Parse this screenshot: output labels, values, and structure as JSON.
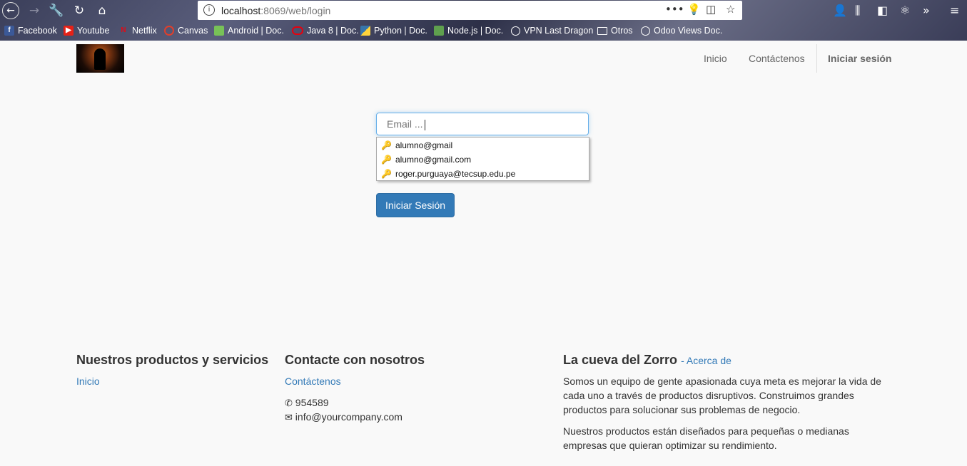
{
  "browser": {
    "url_host": "localhost",
    "url_path": ":8069/web/login",
    "bookmarks": [
      {
        "label": "Facebook",
        "icon": "facebook-icon",
        "color": "#3b5998"
      },
      {
        "label": "Youtube",
        "icon": "youtube-icon",
        "color": "#e62117"
      },
      {
        "label": "Netflix",
        "icon": "netflix-icon",
        "color": "#e50914"
      },
      {
        "label": "Canvas",
        "icon": "canvas-icon",
        "color": "#e13f2b"
      },
      {
        "label": "Android | Doc.",
        "icon": "android-icon",
        "color": "#78c257"
      },
      {
        "label": "Java 8 | Doc.",
        "icon": "oracle-icon",
        "color": "#e8000d"
      },
      {
        "label": "Python | Doc.",
        "icon": "python-icon",
        "color": "#3776ab"
      },
      {
        "label": "Node.js |  Doc.",
        "icon": "nodejs-icon",
        "color": "#5fa04e"
      },
      {
        "label": "VPN Last Dragon",
        "icon": "globe-icon",
        "color": "#ffffff"
      },
      {
        "label": "Otros",
        "icon": "folder-icon",
        "color": "#ffffff"
      },
      {
        "label": "Odoo Views Doc.",
        "icon": "globe-icon",
        "color": "#ffffff"
      }
    ]
  },
  "header": {
    "nav": [
      "Inicio",
      "Contáctenos",
      "Iniciar sesión"
    ]
  },
  "login": {
    "email_placeholder": "Email ...",
    "suggestions": [
      "alumno@gmail",
      "alumno@gmail.com",
      "roger.purguaya@tecsup.edu.pe"
    ],
    "submit_label": "Iniciar Sesión"
  },
  "footer": {
    "products_title": "Nuestros productos y servicios",
    "products_link": "Inicio",
    "contact_title": "Contacte con nosotros",
    "contact_link": "Contáctenos",
    "phone": "954589",
    "email": "info@yourcompany.com",
    "about_title": "La cueva del Zorro",
    "about_link": "- Acerca de",
    "about_p1": "Somos un equipo de gente apasionada cuya meta es mejorar la vida de cada uno a través de productos disruptivos. Construimos grandes productos para solucionar sus problemas de negocio.",
    "about_p2": "Nuestros productos están diseñados para pequeñas o medianas empresas que quieran optimizar su rendimiento."
  },
  "colors": {
    "primary": "#337ab7",
    "focus": "#66afe9"
  }
}
